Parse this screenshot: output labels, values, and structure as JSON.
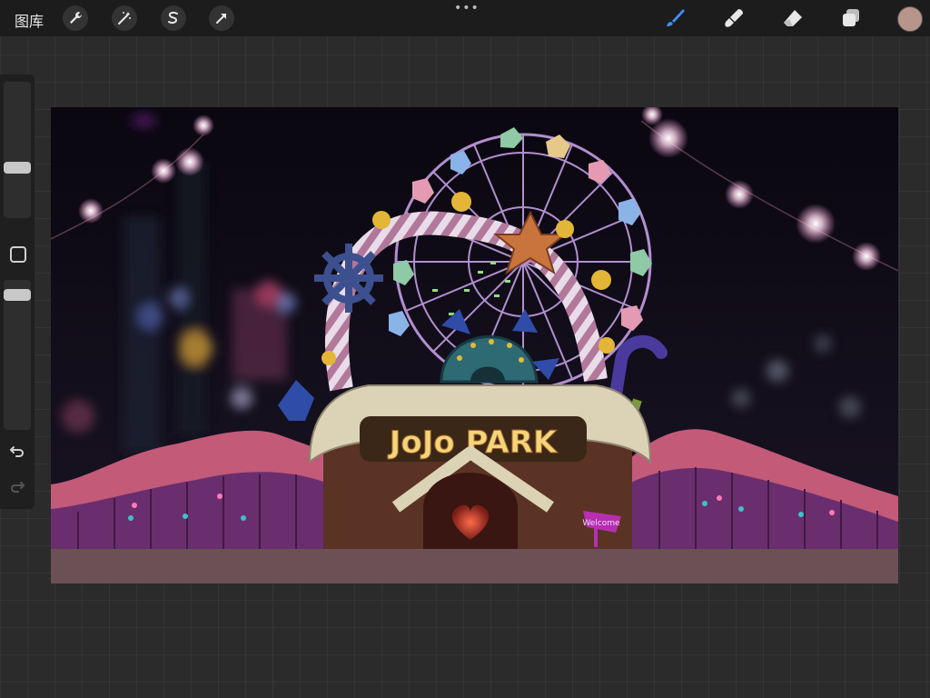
{
  "toolbar": {
    "gallery_label": "图库",
    "left_tools": [
      {
        "icon": "wrench-icon",
        "name": "actions"
      },
      {
        "icon": "magic-wand-icon",
        "name": "adjustments"
      },
      {
        "icon": "selection-s-icon",
        "name": "selection"
      },
      {
        "icon": "arrow-cursor-icon",
        "name": "transform"
      }
    ],
    "more_label": "•••",
    "right_tools": [
      {
        "icon": "brush-icon",
        "name": "paint",
        "active": true
      },
      {
        "icon": "smudge-icon",
        "name": "smudge"
      },
      {
        "icon": "eraser-icon",
        "name": "erase"
      },
      {
        "icon": "layers-icon",
        "name": "layers"
      }
    ],
    "active_color": "#b8958a",
    "accent_color": "#3d8ef7"
  },
  "sidebar": {
    "brush_size": 0.6,
    "opacity": 0.6,
    "undo_icon": "undo-arrow-icon",
    "redo_icon": "redo-arrow-icon",
    "modify_icon": "square-modify-icon"
  },
  "canvas": {
    "sign_text": "JoJo PARK",
    "welcome_text": "Welcome"
  }
}
